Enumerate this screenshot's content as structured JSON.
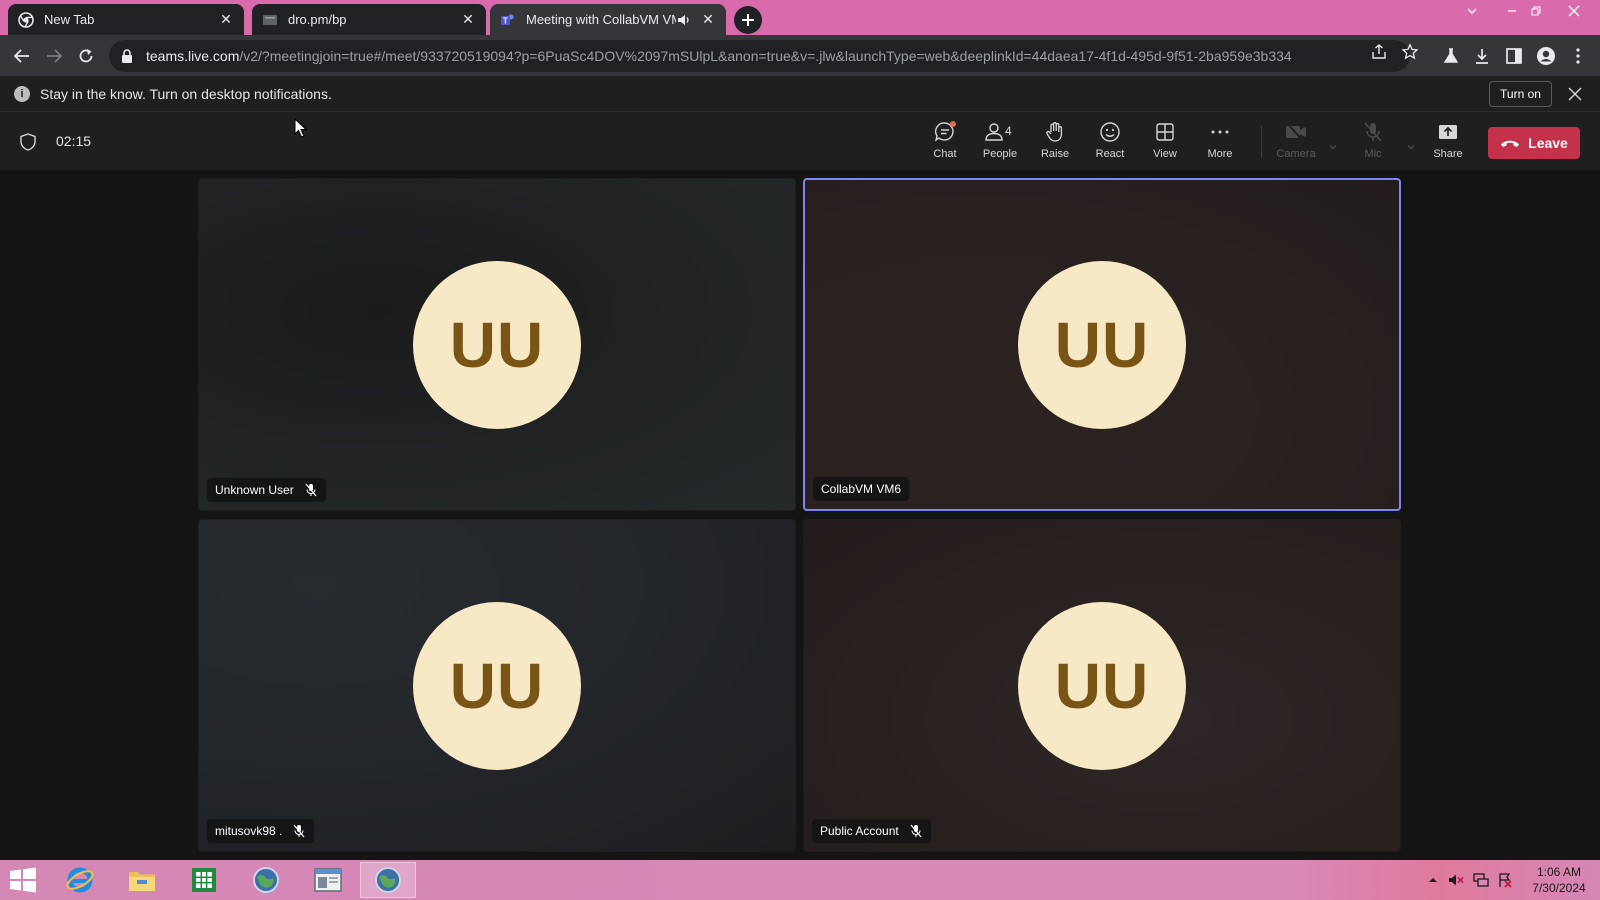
{
  "browser": {
    "tabs": [
      {
        "title": "New Tab",
        "icon": "chrome-icon",
        "active": false
      },
      {
        "title": "dro.pm/bp",
        "icon": "page-icon",
        "active": false
      },
      {
        "title": "Meeting with CollabVM VM",
        "icon": "teams-icon",
        "active": true,
        "audio": true
      }
    ],
    "url": {
      "host": "teams.live.com",
      "path": "/v2/?meetingjoin=true#/meet/933720519094?p=6PuaSc4DOV%2097mSUlpL&anon=true&v=.jlw&launchType=web&deeplinkId=44daea17-4f1d-495d-9f51-2ba959e3b334"
    },
    "colors": {
      "frame": "#d96bac",
      "toolbar": "#35363a"
    }
  },
  "notification": {
    "text": "Stay in the know. Turn on desktop notifications.",
    "button": "Turn on"
  },
  "meeting": {
    "timer": "02:15",
    "controls": [
      {
        "id": "chat",
        "label": "Chat",
        "icon": "chat-icon"
      },
      {
        "id": "people",
        "label": "People",
        "icon": "people-icon",
        "count": "4"
      },
      {
        "id": "raise",
        "label": "Raise",
        "icon": "hand-icon"
      },
      {
        "id": "react",
        "label": "React",
        "icon": "smile-icon"
      },
      {
        "id": "view",
        "label": "View",
        "icon": "grid-icon"
      },
      {
        "id": "more",
        "label": "More",
        "icon": "more-icon"
      },
      {
        "id": "camera",
        "label": "Camera",
        "icon": "camera-off-icon",
        "disabled": true
      },
      {
        "id": "mic",
        "label": "Mic",
        "icon": "mic-off-icon",
        "disabled": true
      },
      {
        "id": "share",
        "label": "Share",
        "icon": "share-icon"
      }
    ],
    "leave_label": "Leave",
    "participants": [
      {
        "name": "Unknown User",
        "initials": "UU",
        "muted": true,
        "active": false
      },
      {
        "name": "CollabVM VM6",
        "initials": "UU",
        "muted": false,
        "active": true
      },
      {
        "name": "mitusovk98 .",
        "initials": "UU",
        "muted": true,
        "active": false
      },
      {
        "name": "Public Account",
        "initials": "UU",
        "muted": true,
        "active": false
      }
    ],
    "colors": {
      "leave": "#c4314b",
      "active_border": "#7f85f5",
      "avatar_bg": "#f8e9c6",
      "avatar_text": "#785515"
    }
  },
  "taskbar": {
    "apps": [
      "internet-explorer-icon",
      "file-explorer-icon",
      "spreadsheet-icon",
      "globe-icon",
      "window-icon",
      "globe-icon"
    ],
    "clock": {
      "time": "1:06 AM",
      "date": "7/30/2024"
    }
  }
}
